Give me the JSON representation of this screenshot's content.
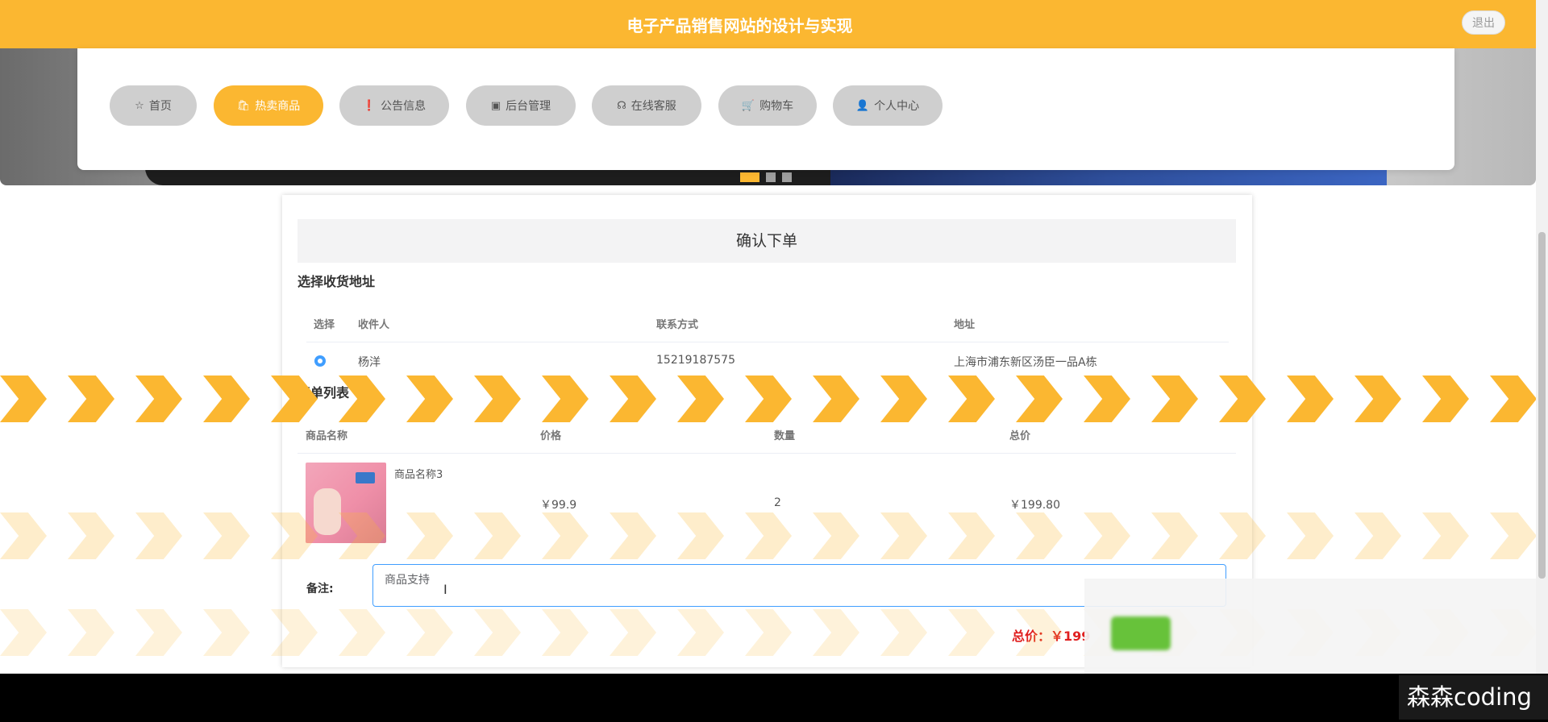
{
  "header": {
    "title": "电子产品销售网站的设计与实现",
    "logout_label": "退出"
  },
  "nav": {
    "items": [
      {
        "label": "首页",
        "icon": "star-icon",
        "glyph": "☆",
        "active": false
      },
      {
        "label": "热卖商品",
        "icon": "shopping-bag-icon",
        "glyph": "🛍",
        "active": true
      },
      {
        "label": "公告信息",
        "icon": "info-icon",
        "glyph": "❗",
        "active": false
      },
      {
        "label": "后台管理",
        "icon": "briefcase-icon",
        "glyph": "▣",
        "active": false
      },
      {
        "label": "在线客服",
        "icon": "headset-icon",
        "glyph": "☊",
        "active": false
      },
      {
        "label": "购物车",
        "icon": "cart-icon",
        "glyph": "🛒",
        "active": false
      },
      {
        "label": "个人中心",
        "icon": "user-icon",
        "glyph": "👤",
        "active": false
      }
    ]
  },
  "banner": {
    "slides": 3,
    "active_slide": 1
  },
  "order": {
    "title": "确认下单",
    "address_section_label": "选择收货地址",
    "address_columns": [
      "选择",
      "收件人",
      "联系方式",
      "地址"
    ],
    "addresses": [
      {
        "selected": true,
        "recipient": "杨洋",
        "phone": "15219187575",
        "address": "上海市浦东新区汤臣一品A栋"
      }
    ],
    "list_section_label": "清单列表",
    "item_columns": [
      "商品名称",
      "价格",
      "数量",
      "总价"
    ],
    "items": [
      {
        "name": "商品名称3",
        "price": "￥99.9",
        "quantity": "2",
        "total": "￥199.80"
      }
    ],
    "note_label": "备注:",
    "note_value": "商品支持",
    "total_label": "总价：￥199"
  },
  "watermark": "森森coding",
  "colors": {
    "brand": "#FBB731",
    "accent": "#409EFF",
    "price": "#e02020",
    "submit": "#67c23a"
  }
}
